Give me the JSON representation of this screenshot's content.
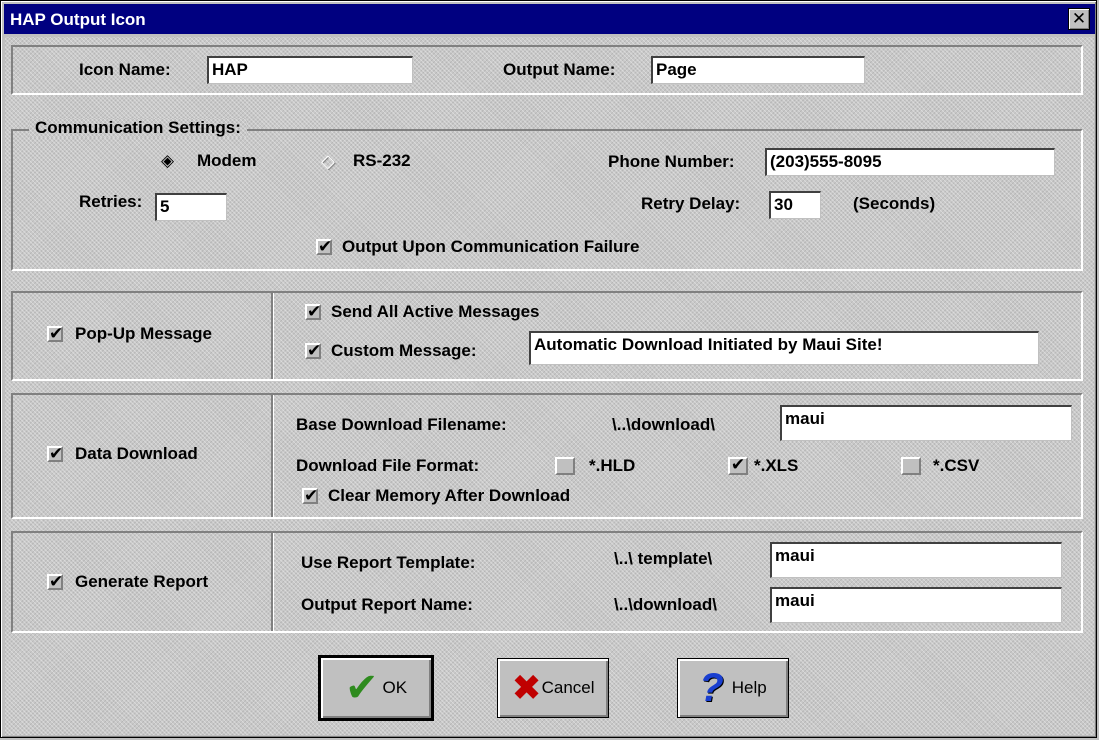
{
  "window": {
    "title": "HAP Output Icon",
    "close_glyph": "✕"
  },
  "names": {
    "icon_name_label": "Icon Name:",
    "icon_name_value": "HAP",
    "output_name_label": "Output Name:",
    "output_name_value": "Page"
  },
  "comm": {
    "group_label": "Communication Settings:",
    "modem_label": "Modem",
    "modem_selected": true,
    "rs232_label": "RS-232",
    "rs232_selected": false,
    "phone_label": "Phone Number:",
    "phone_value": "(203)555-8095",
    "retries_label": "Retries:",
    "retries_value": "5",
    "retry_delay_label": "Retry Delay:",
    "retry_delay_value": "30",
    "seconds_label": "(Seconds)",
    "output_on_failure_label": "Output Upon Communication Failure",
    "output_on_failure_checked": true
  },
  "popup": {
    "label": "Pop-Up Message",
    "checked": true,
    "send_all_label": "Send All Active Messages",
    "send_all_checked": true,
    "custom_label": "Custom Message:",
    "custom_checked": true,
    "custom_value": "Automatic Download Initiated by Maui Site!"
  },
  "download": {
    "label": "Data Download",
    "checked": true,
    "base_label": "Base Download Filename:",
    "base_path": "\\..\\download\\",
    "base_value": "maui",
    "format_label": "Download File Format:",
    "formats": [
      {
        "label": "*.HLD",
        "checked": false
      },
      {
        "label": "*.XLS",
        "checked": true
      },
      {
        "label": "*.CSV",
        "checked": false
      }
    ],
    "clear_label": "Clear Memory After Download",
    "clear_checked": true
  },
  "report": {
    "label": "Generate Report",
    "checked": true,
    "template_label": "Use Report Template:",
    "template_path": "\\..\\ template\\",
    "template_value": "maui",
    "output_label": "Output Report Name:",
    "output_path": "\\..\\download\\",
    "output_value": "maui"
  },
  "buttons": {
    "ok": "OK",
    "cancel": "Cancel",
    "help": "Help"
  },
  "glyphs": {
    "check": "✔",
    "radio_on": "◈",
    "radio_off": "◇",
    "help_icon": "?",
    "ok_icon": "✔",
    "cancel_icon": "✖"
  },
  "colors": {
    "title_bar": "#000080",
    "ok_icon": "#2e8b1e",
    "cancel_icon": "#c00000",
    "help_icon": "#1a3fd0"
  }
}
